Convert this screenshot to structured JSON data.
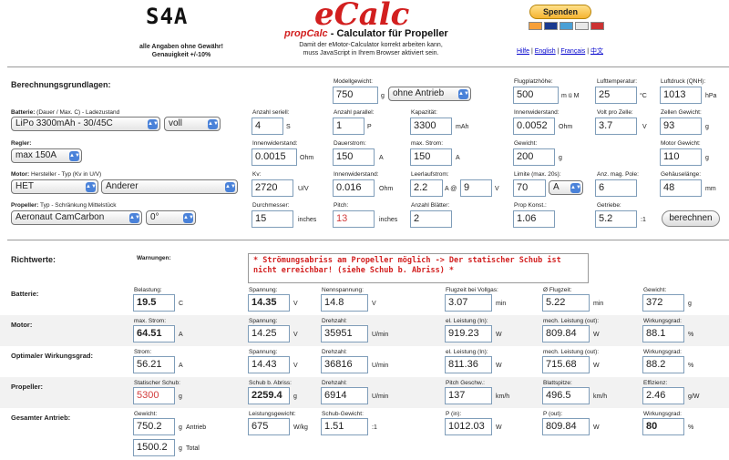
{
  "header": {
    "brand": "S4A",
    "disclaimer_line1": "alle Angaben ohne Gewähr!",
    "disclaimer_line2": "Genauigkeit +/-10%",
    "logo": "eCalc",
    "subtitle_brand": "propCalc",
    "subtitle_rest": " - Calculator für Propeller",
    "desc_line1": "Damit der eMotor-Calculator korrekt arbeiten kann,",
    "desc_line2": "muss JavaScript in Ihrem Browser aktiviert sein.",
    "donate": "Spenden",
    "lang_hilfe": "Hilfe",
    "lang_en": "English",
    "lang_fr": "Français",
    "lang_zh": "中文",
    "sep": " | "
  },
  "calc": {
    "title": "Berechnungsgrundlagen:",
    "modellgewicht": {
      "label": "Modellgewicht:",
      "value": "750",
      "unit": "g"
    },
    "antrieb_select": "ohne Antrieb",
    "flugplatzhoehe": {
      "label": "Flugplatzhöhe:",
      "value": "500",
      "unit": "m ü M"
    },
    "lufttemperatur": {
      "label": "Lufttemperatur:",
      "value": "25",
      "unit": "°C"
    },
    "luftdruck": {
      "label": "Luftdruck (QNH):",
      "value": "1013",
      "unit": "hPa"
    },
    "batterie": {
      "label_bold": "Batterie:",
      "label_rest": " (Dauer / Max. C) - Ladezustand",
      "type_select": "LiPo 3300mAh - 30/45C",
      "state_select": "voll",
      "seriell": {
        "label": "Anzahl seriell:",
        "value": "4",
        "unit": "S"
      },
      "parallel": {
        "label": "Anzahl parallel:",
        "value": "1",
        "unit": "P"
      },
      "kapazitaet": {
        "label": "Kapazität:",
        "value": "3300",
        "unit": "mAh"
      },
      "innenwiderstand": {
        "label": "Innenwiderstand:",
        "value": "0.0052",
        "unit": "Ohm"
      },
      "volt_zelle": {
        "label": "Volt pro Zelle:",
        "value": "3.7",
        "unit": "V"
      },
      "zellen_gewicht": {
        "label": "Zellen Gewicht:",
        "value": "93",
        "unit": "g"
      }
    },
    "regler": {
      "label": "Regler:",
      "select": "max 150A",
      "innenwiderstand": {
        "label": "Innenwiderstand:",
        "value": "0.0015",
        "unit": "Ohm"
      },
      "dauerstrom": {
        "label": "Dauerstrom:",
        "value": "150",
        "unit": "A"
      },
      "max_strom": {
        "label": "max. Strom:",
        "value": "150",
        "unit": "A"
      },
      "gewicht": {
        "label": "Gewicht:",
        "value": "200",
        "unit": "g"
      },
      "motor_gewicht": {
        "label": "Motor Gewicht:",
        "value": "110",
        "unit": "g"
      }
    },
    "motor": {
      "label_bold": "Motor:",
      "label_rest": " Hersteller - Typ (Kv in U/V)",
      "maker_select": "HET",
      "type_select": "Anderer",
      "kv": {
        "label": "Kv:",
        "value": "2720",
        "unit": "U/V"
      },
      "innenwiderstand": {
        "label": "Innenwiderstand:",
        "value": "0.016",
        "unit": "Ohm"
      },
      "leerlaufstrom": {
        "label": "Leerlaufstrom:",
        "value": "2.2",
        "at": "A @",
        "volt": "9",
        "unit": "V"
      },
      "limite": {
        "label": "Limite (max. 20s):",
        "value": "70",
        "select": "A"
      },
      "pole": {
        "label": "Anz. mag. Pole:",
        "value": "6"
      },
      "gehaeuselaenge": {
        "label": "Gehäuselänge:",
        "value": "48",
        "unit": "mm"
      }
    },
    "propeller": {
      "label_bold": "Propeller:",
      "label_rest": " Typ - Schränkung Mittelstück",
      "type_select": "Aeronaut CamCarbon",
      "angle_select": "0°",
      "durchmesser": {
        "label": "Durchmesser:",
        "value": "15",
        "unit": "inches"
      },
      "pitch": {
        "label": "Pitch:",
        "value": "13",
        "unit": "inches"
      },
      "blaetter": {
        "label": "Anzahl Blätter:",
        "value": "2"
      },
      "konst": {
        "label": "Prop Konst.:",
        "value": "1.06"
      },
      "getriebe": {
        "label": "Getriebe:",
        "value": "5.2",
        "unit": ":1"
      },
      "button": "berechnen"
    }
  },
  "results": {
    "title": "Richtwerte:",
    "warn_label": "Warnungen:",
    "warning": "* Strömungsabriss am Propeller möglich -> Der statischer Schub ist nicht erreichbar! (siehe Schub b. Abriss) *",
    "rows": [
      {
        "title": "Batterie:",
        "cells": [
          {
            "label": "Belastung:",
            "value": "19.5",
            "unit": "C",
            "bold": true
          },
          {
            "label": "Spannung:",
            "value": "14.35",
            "unit": "V",
            "bold": true
          },
          {
            "label": "Nennspannung:",
            "value": "14.8",
            "unit": "V"
          },
          {
            "label": "Flugzeit bei Vollgas:",
            "value": "3.07",
            "unit": "min"
          },
          {
            "label": "Ø Flugzeit:",
            "value": "5.22",
            "unit": "min"
          },
          {
            "label": "Gewicht:",
            "value": "372",
            "unit": "g"
          }
        ]
      },
      {
        "title": "Motor:",
        "cells": [
          {
            "label": "max. Strom:",
            "value": "64.51",
            "unit": "A",
            "bold": true
          },
          {
            "label": "Spannung:",
            "value": "14.25",
            "unit": "V"
          },
          {
            "label": "Drehzahl:",
            "value": "35951",
            "unit": "U/min"
          },
          {
            "label": "el. Leistung (In):",
            "value": "919.23",
            "unit": "W"
          },
          {
            "label": "mech. Leistung (out):",
            "value": "809.84",
            "unit": "W"
          },
          {
            "label": "Wirkungsgrad:",
            "value": "88.1",
            "unit": "%"
          }
        ]
      },
      {
        "title": "Optimaler Wirkungsgrad:",
        "cells": [
          {
            "label": "Strom:",
            "value": "56.21",
            "unit": "A"
          },
          {
            "label": "Spannung:",
            "value": "14.43",
            "unit": "V"
          },
          {
            "label": "Drehzahl:",
            "value": "36816",
            "unit": "U/min"
          },
          {
            "label": "el. Leistung (In):",
            "value": "811.36",
            "unit": "W"
          },
          {
            "label": "mech. Leistung (out):",
            "value": "715.68",
            "unit": "W"
          },
          {
            "label": "Wirkungsgrad:",
            "value": "88.2",
            "unit": "%"
          }
        ]
      },
      {
        "title": "Propeller:",
        "cells": [
          {
            "label": "Statischer Schub:",
            "value": "5300",
            "unit": "g",
            "red": true
          },
          {
            "label": "Schub b. Abriss:",
            "value": "2259.4",
            "unit": "g",
            "bold": true
          },
          {
            "label": "Drehzahl:",
            "value": "6914",
            "unit": "U/min"
          },
          {
            "label": "Pitch Geschw.:",
            "value": "137",
            "unit": "km/h"
          },
          {
            "label": "Blattspitze:",
            "value": "496.5",
            "unit": "km/h"
          },
          {
            "label": "Effizienz:",
            "value": "2.46",
            "unit": "g/W"
          }
        ]
      },
      {
        "title": "Gesamter Antrieb:",
        "cells": [
          {
            "label": "Gewicht:",
            "value": "750.2",
            "unit": "g",
            "extra": "Antrieb"
          },
          {
            "label": "Leistungsgewicht:",
            "value": "675",
            "unit": "W/kg"
          },
          {
            "label": "Schub-Gewicht:",
            "value": "1.51",
            "unit": ":1"
          },
          {
            "label": "P (in):",
            "value": "1012.03",
            "unit": "W"
          },
          {
            "label": "P (out):",
            "value": "809.84",
            "unit": "W"
          },
          {
            "label": "Wirkungsgrad:",
            "value": "80",
            "unit": "%",
            "bold": true
          }
        ]
      }
    ],
    "total": {
      "value": "1500.2",
      "unit": "g",
      "extra": "Total"
    }
  }
}
